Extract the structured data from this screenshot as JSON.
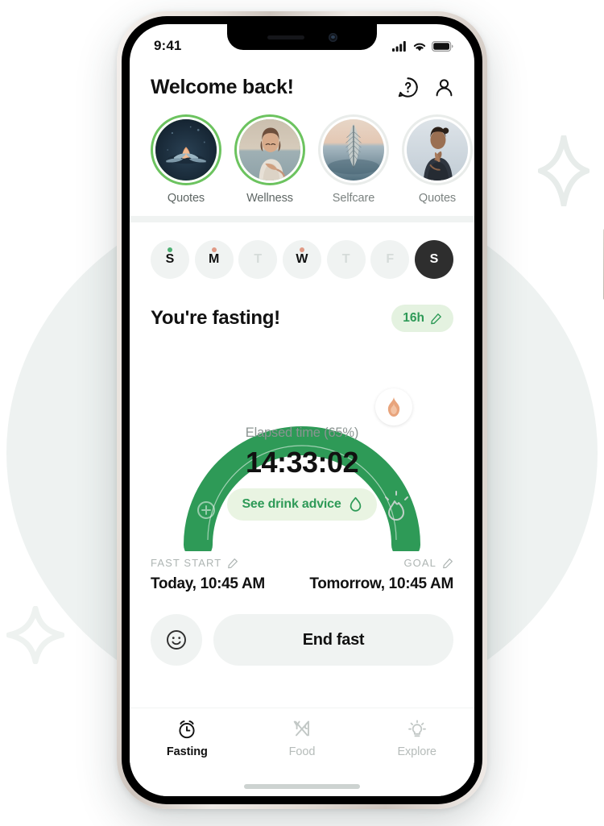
{
  "background": {
    "circle_color": "#eef2f1",
    "sparkles": [
      "sparkle-top-right",
      "sparkle-bottom-left"
    ]
  },
  "colors": {
    "brand_green": "#2e9a57",
    "ring_green": "#2e9a57",
    "ring_track": "#eef2f1",
    "badge_bg": "#e4f2e0",
    "accent_orange": "#e8a47c",
    "story_ring_unseen": "#6cc35f",
    "surface": "#f0f3f2",
    "text_primary": "#111111",
    "text_muted": "#8b9492"
  },
  "status_bar": {
    "time": "9:41",
    "icons": [
      "cellular-signal-icon",
      "wifi-icon",
      "battery-icon"
    ]
  },
  "header": {
    "title": "Welcome back!",
    "icons": [
      {
        "name": "help-chat-icon",
        "label": "Help"
      },
      {
        "name": "profile-icon",
        "label": "Profile"
      }
    ]
  },
  "stories": [
    {
      "label": "Quotes",
      "seen": false,
      "image": "lotus-flower-photo"
    },
    {
      "label": "Wellness",
      "seen": false,
      "image": "woman-meditating-photo"
    },
    {
      "label": "Selfcare",
      "seen": true,
      "image": "feather-sunset-photo"
    },
    {
      "label": "Quotes",
      "seen": true,
      "image": "woman-praying-photo"
    },
    {
      "label": "",
      "seen": true,
      "image": "partial-photo"
    }
  ],
  "days": [
    {
      "letter": "S",
      "dot": "#4caf72",
      "state": "logged"
    },
    {
      "letter": "M",
      "dot": "#e09a85",
      "state": "logged"
    },
    {
      "letter": "T",
      "dot": null,
      "state": "empty"
    },
    {
      "letter": "W",
      "dot": "#e09a85",
      "state": "logged"
    },
    {
      "letter": "T",
      "dot": null,
      "state": "empty"
    },
    {
      "letter": "F",
      "dot": null,
      "state": "empty"
    },
    {
      "letter": "S",
      "dot": null,
      "state": "selected"
    }
  ],
  "fasting": {
    "title": "You're fasting!",
    "plan_badge": "16h",
    "plan_badge_icon": "pencil-edit-icon",
    "elapsed_label": "Elapsed time (65%)",
    "timer": "14:33:02",
    "progress_percent": 65,
    "drink_advice_label": "See drink advice",
    "drink_advice_icon": "water-drop-icon",
    "thumb_icon": "flame-icon",
    "ring_icons": [
      "stomach-icon",
      "minus-circle-icon",
      "plus-circle-icon",
      "fat-burn-flame-icon"
    ]
  },
  "schedule": {
    "start": {
      "caption": "FAST START",
      "caption_icon": "pencil-edit-icon",
      "value": "Today, 10:45 AM"
    },
    "goal": {
      "caption": "GOAL",
      "caption_icon": "pencil-edit-icon",
      "value": "Tomorrow, 10:45 AM"
    }
  },
  "actions": {
    "mood_button_icon": "smiley-face-icon",
    "end_fast_label": "End fast"
  },
  "tabbar": {
    "items": [
      {
        "label": "Fasting",
        "icon": "alarm-clock-icon",
        "active": true
      },
      {
        "label": "Food",
        "icon": "fork-knife-icon",
        "active": false
      },
      {
        "label": "Explore",
        "icon": "lightbulb-icon",
        "active": false
      }
    ]
  }
}
